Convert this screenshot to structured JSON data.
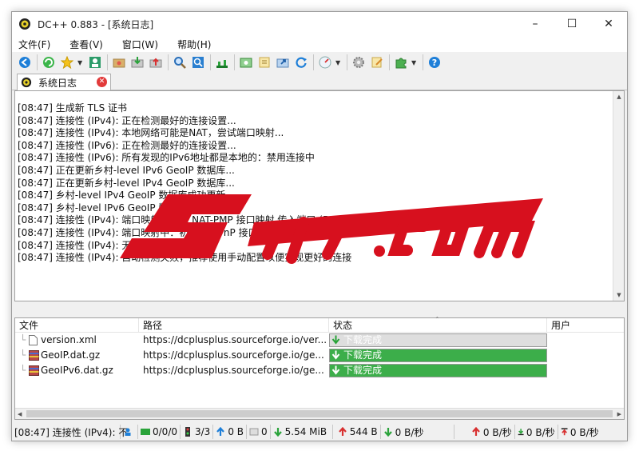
{
  "window": {
    "title": "DC++ 0.883 - [系统日志]"
  },
  "menu": [
    "文件(F)",
    "查看(V)",
    "窗口(W)",
    "帮助(H)"
  ],
  "tab": {
    "label": "系统日志"
  },
  "log": [
    "[08:47] 生成新 TLS 证书",
    "[08:47] 连接性 (IPv4): 正在检测最好的连接设置...",
    "[08:47] 连接性 (IPv4): 本地网络可能是NAT，尝试端口映射...",
    "[08:47] 连接性 (IPv6): 正在检测最好的连接设置...",
    "[08:47] 连接性 (IPv6): 所有发现的IPv6地址都是本地的：禁用连接中",
    "[08:47] 正在更新乡村-level IPv6 GeoIP 数据库...",
    "[08:47] 正在更新乡村-level IPv4 GeoIP 数据库...",
    "[08:47] 乡村-level IPv4 GeoIP 数据库成功更新",
    "[08:47] 乡村-level IPv6 GeoIP 数据库成功更新",
    "[08:47] 连接性 (IPv4): 端口映射：创建 NAT-PMP 接口映射 传入端口 (51984 TCP)失败",
    "[08:47] 连接性 (IPv4): 端口映射中：初始化 UPnP 接口映射",
    "[08:47] 连接性 (IPv4): 无法创建端口映射",
    "[08:47] 连接性 (IPv4): 自动检测失败，推荐使用手动配置以便实现更好的连接"
  ],
  "table": {
    "columns": [
      "文件",
      "路径",
      "状态",
      "用户"
    ],
    "rows": [
      {
        "file": "version.xml",
        "path": "https://dcplusplus.sourceforge.io/ver...",
        "status": "下载完成",
        "active": false
      },
      {
        "file": "GeoIP.dat.gz",
        "path": "https://dcplusplus.sourceforge.io/ge...",
        "status": "下载完成",
        "active": true
      },
      {
        "file": "GeoIPv6.dat.gz",
        "path": "https://dcplusplus.sourceforge.io/ge...",
        "status": "下载完成",
        "active": true
      }
    ]
  },
  "statusbar": {
    "message": "[08:47] 连接性 (IPv4): 不",
    "hubs": "0/0/0",
    "slots": "3/3",
    "upload_total": "0 B",
    "queue_count": "0",
    "download_total": "5.54 MiB",
    "up_total": "544 B",
    "down_rate": "0 B/秒",
    "up_rate": "0 B/秒",
    "down_limit": "0 B/秒",
    "up_limit": "0 B/秒"
  },
  "colors": {
    "progress_green": "#3cae4a",
    "inactive_bar": "#dedede",
    "accent_blue": "#1e7fd8",
    "error_red": "#e23a3a"
  },
  "watermark": "5iltr.com"
}
